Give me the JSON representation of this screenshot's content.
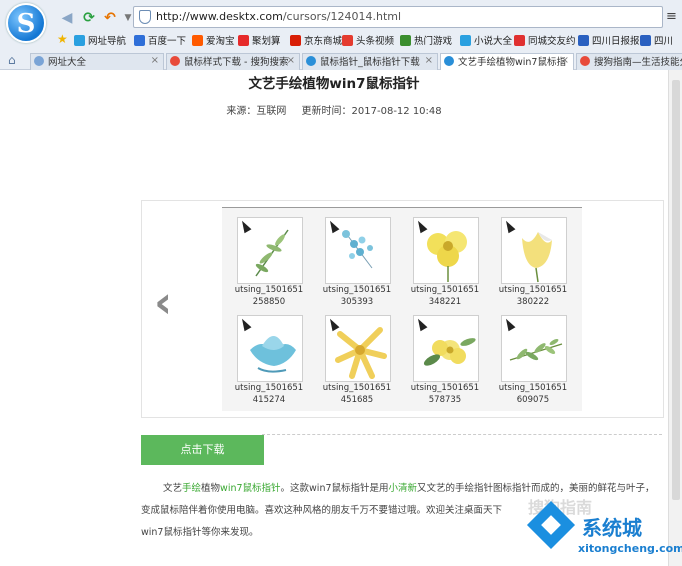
{
  "browser": {
    "logo_letter": "S",
    "url_host": "http://www.desktx.com",
    "url_path": "/cursors/124014.html"
  },
  "favorites": [
    {
      "label": "网址导航",
      "color": "#2aa0e0"
    },
    {
      "label": "百度一下",
      "color": "#2f6fd8"
    },
    {
      "label": "爱淘宝",
      "color": "#ff5a00"
    },
    {
      "label": "聚划算",
      "color": "#e62a2a"
    },
    {
      "label": "京东商城",
      "color": "#d81e06"
    },
    {
      "label": "头条视频",
      "color": "#e43b2f"
    },
    {
      "label": "热门游戏",
      "color": "#3b8e2e"
    },
    {
      "label": "小说大全",
      "color": "#2aa0e0"
    },
    {
      "label": "同城交友约",
      "color": "#e03030"
    },
    {
      "label": "四川日报报",
      "color": "#2a60c0"
    },
    {
      "label": "四川",
      "color": "#2a60c0"
    }
  ],
  "tabs": [
    {
      "label": "网址大全",
      "color": "#7aa4d6"
    },
    {
      "label": "鼠标样式下载 - 搜狗搜索",
      "color": "#e84a3a"
    },
    {
      "label": "鼠标指针_鼠标指针下载",
      "color": "#2a8fd8"
    },
    {
      "label": "文艺手绘植物win7鼠标指",
      "color": "#2a8fd8"
    },
    {
      "label": "搜狗指南—生活技能分享",
      "color": "#e84a3a"
    }
  ],
  "article": {
    "title": "文艺手绘植物win7鼠标指针",
    "source": "来源：互联网",
    "updated": "更新时间：2017-08-12 10:48"
  },
  "gallery": {
    "items": [
      {
        "caption_line1": "utsing_1501651",
        "caption_line2": "258850",
        "plant": "twig"
      },
      {
        "caption_line1": "utsing_1501651",
        "caption_line2": "305393",
        "plant": "blue-buds"
      },
      {
        "caption_line1": "utsing_1501651",
        "caption_line2": "348221",
        "plant": "yellow-flower"
      },
      {
        "caption_line1": "utsing_1501651",
        "caption_line2": "380222",
        "plant": "yellow-tulip"
      },
      {
        "caption_line1": "utsing_1501651",
        "caption_line2": "415274",
        "plant": "blue-lotus"
      },
      {
        "caption_line1": "utsing_1501651",
        "caption_line2": "451685",
        "plant": "yellow-lily"
      },
      {
        "caption_line1": "utsing_1501651",
        "caption_line2": "578735",
        "plant": "yellow-blossom"
      },
      {
        "caption_line1": "utsing_1501651",
        "caption_line2": "609075",
        "plant": "green-leaves"
      }
    ]
  },
  "download_button": "点击下载",
  "paragraph": {
    "p1": "文艺",
    "k1": "手绘",
    "p2": "植物",
    "k2": "win7鼠标指针",
    "p3": "。这款win7鼠标指针是用",
    "k3": "小清新",
    "p4": "又文艺的手绘指针图标指针而成的，美丽的鲜花与叶子，变成鼠标陪伴着你使用电脑。喜欢这种风格的朋友千万不要错过哦。欢迎关注桌面天下",
    "p5": "win7鼠标指针等你来发现。"
  },
  "watermark": {
    "brand": "系统城",
    "site": "xitongcheng.com",
    "ghost": "搜狗指南"
  }
}
